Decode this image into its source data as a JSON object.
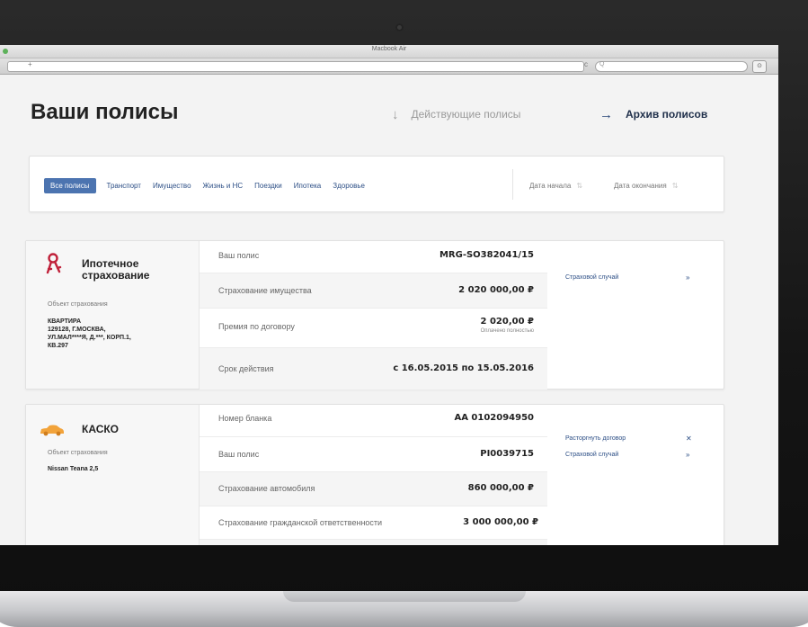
{
  "window": {
    "title": "Macbook Air",
    "url_glyph": "+",
    "reload_glyph": "c",
    "search_glyph": "Q",
    "toolbar_button_glyph": "⊙"
  },
  "header": {
    "title": "Ваши полисы",
    "tab_active": "Действующие полисы",
    "tab_archive": "Архив полисов"
  },
  "filters": {
    "items": [
      "Все полисы",
      "Транспорт",
      "Имущество",
      "Жизнь и НС",
      "Поездки",
      "Ипотека",
      "Здоровье"
    ],
    "active": "Все полисы",
    "sort_start": "Дата начала",
    "sort_end": "Дата окончания"
  },
  "cards": [
    {
      "icon": "key-icon",
      "title_line1": "Ипотечное",
      "title_line2": "страхование",
      "object_label": "Объект страхования",
      "object_lines": [
        "КВАРТИРА",
        "129128, Г.МОСКВА,",
        "УЛ.МАЛ****Я, Д.***, КОРП.1,",
        "КВ.297"
      ],
      "rows": [
        {
          "label": "Ваш полис",
          "value": "MRG-SO382041/15",
          "sub": ""
        },
        {
          "label": "Страхование имущества",
          "value": "2 020 000,00 ₽",
          "sub": ""
        },
        {
          "label": "Премия по договору",
          "value": "2 020,00 ₽",
          "sub": "Оплачено полностью"
        },
        {
          "label": "Срок действия",
          "value": "с 16.05.2015 по 15.05.2016",
          "sub": ""
        }
      ],
      "actions": [
        {
          "label": "Страховой случай",
          "icon": "siren-icon",
          "glyph": "»"
        }
      ]
    },
    {
      "icon": "car-icon",
      "title_line1": "КАСКО",
      "object_label": "Объект страхования",
      "object_lines": [
        "Nissan Teana 2,5"
      ],
      "rows": [
        {
          "label": "Номер бланка",
          "value": "AA 0102094950",
          "sub": ""
        },
        {
          "label": "Ваш полис",
          "value": "PI0039715",
          "sub": ""
        },
        {
          "label": "Страхование автомобиля",
          "value": "860 000,00 ₽",
          "sub": ""
        },
        {
          "label": "Страхование гражданской ответственности",
          "value": "3 000 000,00 ₽",
          "sub": ""
        }
      ],
      "actions": [
        {
          "label": "Расторгнуть договор",
          "icon": "close-icon",
          "glyph": "✕"
        },
        {
          "label": "Страховой случай",
          "icon": "siren-icon",
          "glyph": "»"
        }
      ]
    }
  ],
  "colors": {
    "accent": "#4c74b0",
    "link": "#2d4f86",
    "key_icon": "#c0213a",
    "car_icon": "#f2a33a"
  }
}
